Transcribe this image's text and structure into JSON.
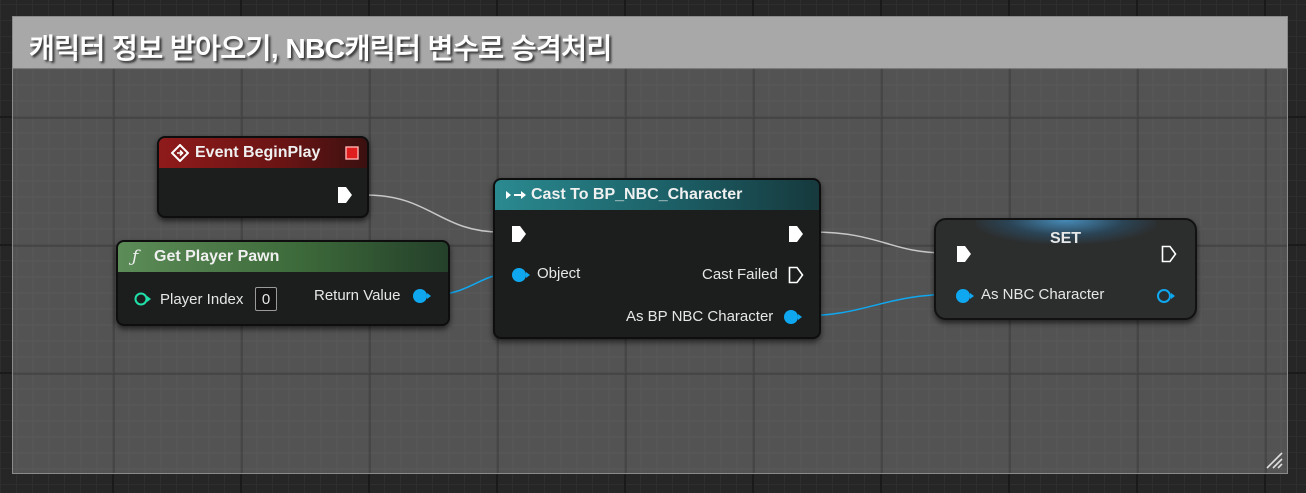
{
  "comment": {
    "title": "캐릭터 정보 받아오기, NBC캐릭터 변수로 승격처리"
  },
  "nodes": {
    "event_begin_play": {
      "title": "Event BeginPlay"
    },
    "get_player_pawn": {
      "title": "Get Player Pawn",
      "function_glyph": "ƒ",
      "input_label": "Player Index",
      "input_value": "0",
      "output_label": "Return Value"
    },
    "cast_to": {
      "title": "Cast To BP_NBC_Character",
      "object_label": "Object",
      "cast_failed_label": "Cast Failed",
      "output_label": "As BP NBC Character"
    },
    "set": {
      "title": "SET",
      "variable_label": "As NBC Character"
    }
  },
  "colors": {
    "event_header": "#8f1b1b",
    "function_header": "#4a7a46",
    "cast_header": "#1f6e73",
    "object_pin": "#0fa8f0",
    "integer_pin": "#1fe0a8",
    "exec_wire": "#d0d0d0"
  },
  "icons": {
    "event": "event-diamond-icon",
    "delegate": "delegate-square-icon",
    "cast": "cast-arrow-icon",
    "resize": "resize-grip-icon"
  }
}
